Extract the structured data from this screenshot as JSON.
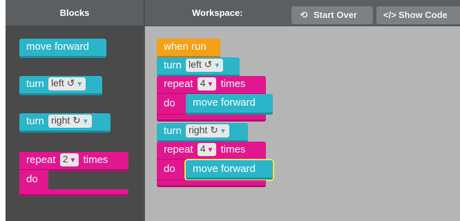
{
  "header": {
    "blocks_title": "Blocks",
    "workspace_title": "Workspace:",
    "start_over": "Start Over",
    "show_code": "Show Code",
    "start_over_icon": "⟲",
    "show_code_icon": "</>"
  },
  "toolbox": {
    "move_forward": "move forward",
    "turn_left": {
      "label": "turn",
      "value": "left ↺"
    },
    "turn_right": {
      "label": "turn",
      "value": "right ↻"
    },
    "repeat": {
      "label": "repeat",
      "count": "2",
      "times": "times",
      "do": "do"
    }
  },
  "workspace": {
    "when_run": "when run",
    "turn1": {
      "label": "turn",
      "value": "left ↺"
    },
    "repeat1": {
      "label": "repeat",
      "count": "4",
      "times": "times",
      "do": "do",
      "inner": "move forward"
    },
    "turn2": {
      "label": "turn",
      "value": "right ↻"
    },
    "repeat2": {
      "label": "repeat",
      "count": "4",
      "times": "times",
      "do": "do",
      "inner": "move forward"
    }
  },
  "colors": {
    "motion": "#2bb5c9",
    "loop": "#e2168f",
    "event": "#f6a017",
    "selection": "#f1e64f"
  }
}
